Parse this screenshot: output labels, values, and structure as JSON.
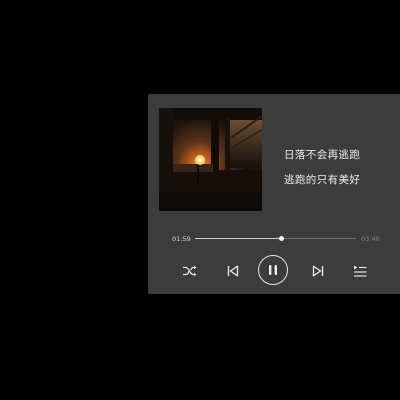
{
  "lyrics": {
    "line1": "日落不会再逃跑",
    "line2": "逃跑的只有美好"
  },
  "playback": {
    "elapsed": "01:59",
    "total": "03:40",
    "progress_fraction": 0.54,
    "state": "playing"
  },
  "controls": {
    "shuffle_icon": "shuffle-icon",
    "prev_icon": "skip-previous-icon",
    "play_pause_icon": "pause-icon",
    "next_icon": "skip-next-icon",
    "playlist_icon": "playlist-icon"
  },
  "colors": {
    "card_background": "#3c3c3c",
    "text": "#ececec",
    "sunset_accent": "#ff9a1e"
  }
}
